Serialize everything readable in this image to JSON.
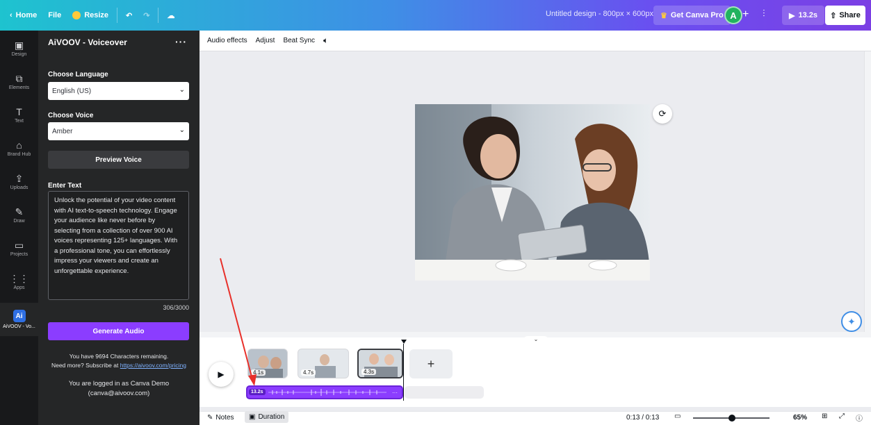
{
  "topbar": {
    "home": "Home",
    "file": "File",
    "resize": "Resize",
    "title": "Untitled design - 800px × 600px",
    "get_pro": "Get Canva Pro",
    "avatar_initial": "A",
    "play_time": "13.2s",
    "share": "Share"
  },
  "rail": [
    {
      "label": "Design",
      "icon": "▣"
    },
    {
      "label": "Elements",
      "icon": "⧉"
    },
    {
      "label": "Text",
      "icon": "T"
    },
    {
      "label": "Brand Hub",
      "icon": "⌂"
    },
    {
      "label": "Uploads",
      "icon": "⇪"
    },
    {
      "label": "Draw",
      "icon": "✎"
    },
    {
      "label": "Projects",
      "icon": "▭"
    },
    {
      "label": "Apps",
      "icon": "⋮⋮"
    },
    {
      "label": "AiVOOV - Vo...",
      "icon": "Ai"
    }
  ],
  "panel": {
    "title": "AiVOOV - Voiceover",
    "language_label": "Choose Language",
    "language_value": "English (US)",
    "voice_label": "Choose Voice",
    "voice_value": "Amber",
    "preview_button": "Preview Voice",
    "text_label": "Enter Text",
    "text_value": "Unlock the potential of your video content with AI text-to-speech technology. Engage your audience like never before by selecting from a collection of over 900 AI voices representing 125+ languages. With a professional tone, you can effortlessly impress your viewers and create an unforgettable experience.",
    "char_count": "306/3000",
    "generate_button": "Generate Audio",
    "remaining_text": "You have 9694 Characters remaining.",
    "need_more": "Need more? Subscribe at",
    "pricing_link": "https://aivoov.com/pricing",
    "logged_in_line1": "You are logged in as Canva Demo",
    "logged_in_line2": "(canva@aivoov.com)"
  },
  "toolbar": {
    "audio_effects": "Audio effects",
    "adjust": "Adjust",
    "beat_sync": "Beat Sync"
  },
  "timeline": {
    "clips": [
      {
        "duration": "4.1s"
      },
      {
        "duration": "4.7s"
      },
      {
        "duration": "4.3s"
      }
    ],
    "audio_label": "13.2s"
  },
  "bottom": {
    "notes": "Notes",
    "duration": "Duration",
    "time": "0:13 / 0:13",
    "zoom": "65%",
    "zoom_level": 0.51
  },
  "colors": {
    "accent_purple": "#8b3dff",
    "panel_bg": "#252627",
    "rail_bg": "#18191b",
    "annotation_red": "#e8302a"
  }
}
